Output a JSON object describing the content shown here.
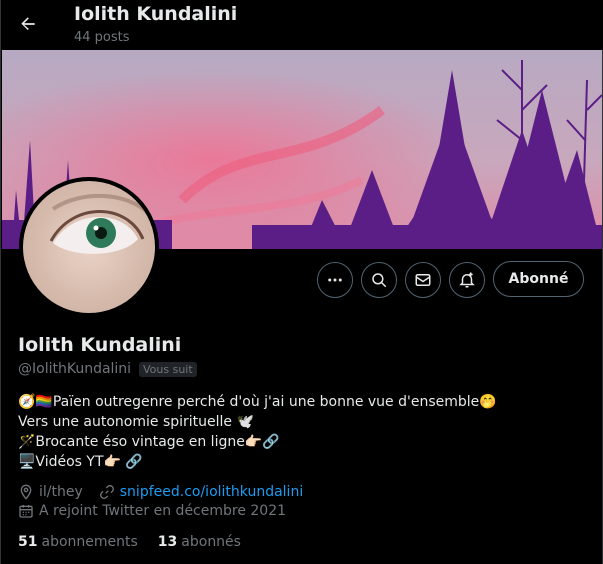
{
  "header": {
    "name": "Iolith Kundalini",
    "posts": "44 posts"
  },
  "profile": {
    "display_name": "Iolith Kundalini",
    "handle": "@IolithKundalini",
    "follows_you": "Vous suit",
    "follow_button": "Abonné",
    "bio": [
      "🧭🏳️‍🌈Païen outregenre perché d'où j'ai une bonne vue d'ensemble🤭",
      "Vers une autonomie spirituelle 🕊️",
      "🪄Brocante éso vintage en ligne👉🏻🔗",
      "🖥️Vidéos YT👉🏻 🔗"
    ],
    "pronouns": "il/they",
    "website": "snipfeed.co/iolithkundalini",
    "joined": "A rejoint Twitter en décembre 2021",
    "following_count": "51",
    "following_label": "abonnements",
    "followers_count": "13",
    "followers_label": "abonnés"
  },
  "icons": {
    "back": "arrow-left-icon",
    "more": "more-horizontal-icon",
    "search": "search-icon",
    "message": "envelope-icon",
    "notify": "bell-plus-icon",
    "location": "location-pin-icon",
    "link": "link-icon",
    "calendar": "calendar-icon"
  },
  "colors": {
    "accent": "#1d9bf0",
    "muted": "#71767b",
    "text": "#e7e9ea",
    "banner_tint": "#5b1e86"
  }
}
